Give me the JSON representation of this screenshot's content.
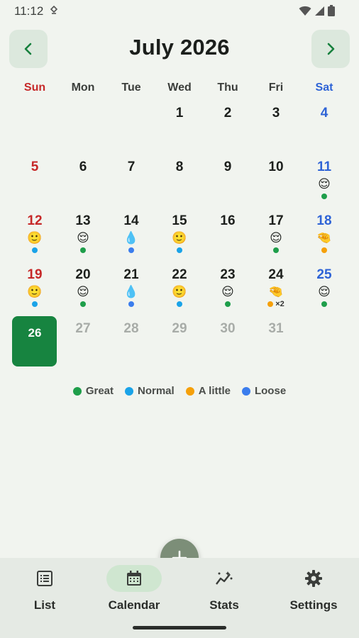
{
  "status_bar": {
    "time": "11:12"
  },
  "header": {
    "title": "July 2026"
  },
  "weekdays": [
    "Sun",
    "Mon",
    "Tue",
    "Wed",
    "Thu",
    "Fri",
    "Sat"
  ],
  "colors": {
    "great": "#1e9e4a",
    "normal": "#1aa3e8",
    "a_little": "#f5a00a",
    "loose": "#3b7ded",
    "today": "#178440"
  },
  "legend": [
    {
      "label": "Great",
      "color": "#1e9e4a"
    },
    {
      "label": "Normal",
      "color": "#1aa3e8"
    },
    {
      "label": "A little",
      "color": "#f5a00a"
    },
    {
      "label": "Loose",
      "color": "#3b7ded"
    }
  ],
  "calendar": {
    "first_weekday": 3,
    "today": 26,
    "days": [
      {
        "day": 1
      },
      {
        "day": 2
      },
      {
        "day": 3
      },
      {
        "day": 4
      },
      {
        "day": 5
      },
      {
        "day": 6
      },
      {
        "day": 7
      },
      {
        "day": 8
      },
      {
        "day": 9
      },
      {
        "day": 10
      },
      {
        "day": 11,
        "emoji": "😌",
        "dots": [
          "#1e9e4a"
        ]
      },
      {
        "day": 12,
        "emoji": "🙂",
        "dots": [
          "#1aa3e8"
        ]
      },
      {
        "day": 13,
        "emoji": "😌",
        "dots": [
          "#1e9e4a"
        ]
      },
      {
        "day": 14,
        "emoji": "💧",
        "dots": [
          "#3b7ded"
        ]
      },
      {
        "day": 15,
        "emoji": "🙂",
        "dots": [
          "#1aa3e8"
        ]
      },
      {
        "day": 16
      },
      {
        "day": 17,
        "emoji": "😌",
        "dots": [
          "#1e9e4a"
        ]
      },
      {
        "day": 18,
        "emoji": "🤏",
        "dots": [
          "#f5a00a"
        ]
      },
      {
        "day": 19,
        "emoji": "🙂",
        "dots": [
          "#1aa3e8"
        ]
      },
      {
        "day": 20,
        "emoji": "😌",
        "dots": [
          "#1e9e4a"
        ]
      },
      {
        "day": 21,
        "emoji": "💧",
        "dots": [
          "#3b7ded"
        ]
      },
      {
        "day": 22,
        "emoji": "🙂",
        "dots": [
          "#1aa3e8"
        ]
      },
      {
        "day": 23,
        "emoji": "😌",
        "dots": [
          "#1e9e4a"
        ]
      },
      {
        "day": 24,
        "emoji": "🤏",
        "dots": [
          "#f5a00a"
        ],
        "count": "×2"
      },
      {
        "day": 25,
        "emoji": "😌",
        "dots": [
          "#1e9e4a"
        ]
      },
      {
        "day": 26,
        "today": true
      },
      {
        "day": 27,
        "future": true
      },
      {
        "day": 28,
        "future": true
      },
      {
        "day": 29,
        "future": true
      },
      {
        "day": 30,
        "future": true
      },
      {
        "day": 31,
        "future": true
      }
    ]
  },
  "bottom_nav": {
    "items": [
      {
        "label": "List",
        "icon": "list-icon"
      },
      {
        "label": "Calendar",
        "icon": "calendar-icon",
        "active": true
      },
      {
        "label": "Stats",
        "icon": "stats-icon"
      },
      {
        "label": "Settings",
        "icon": "gear-icon"
      }
    ]
  },
  "fab": {
    "icon": "plus-icon"
  }
}
